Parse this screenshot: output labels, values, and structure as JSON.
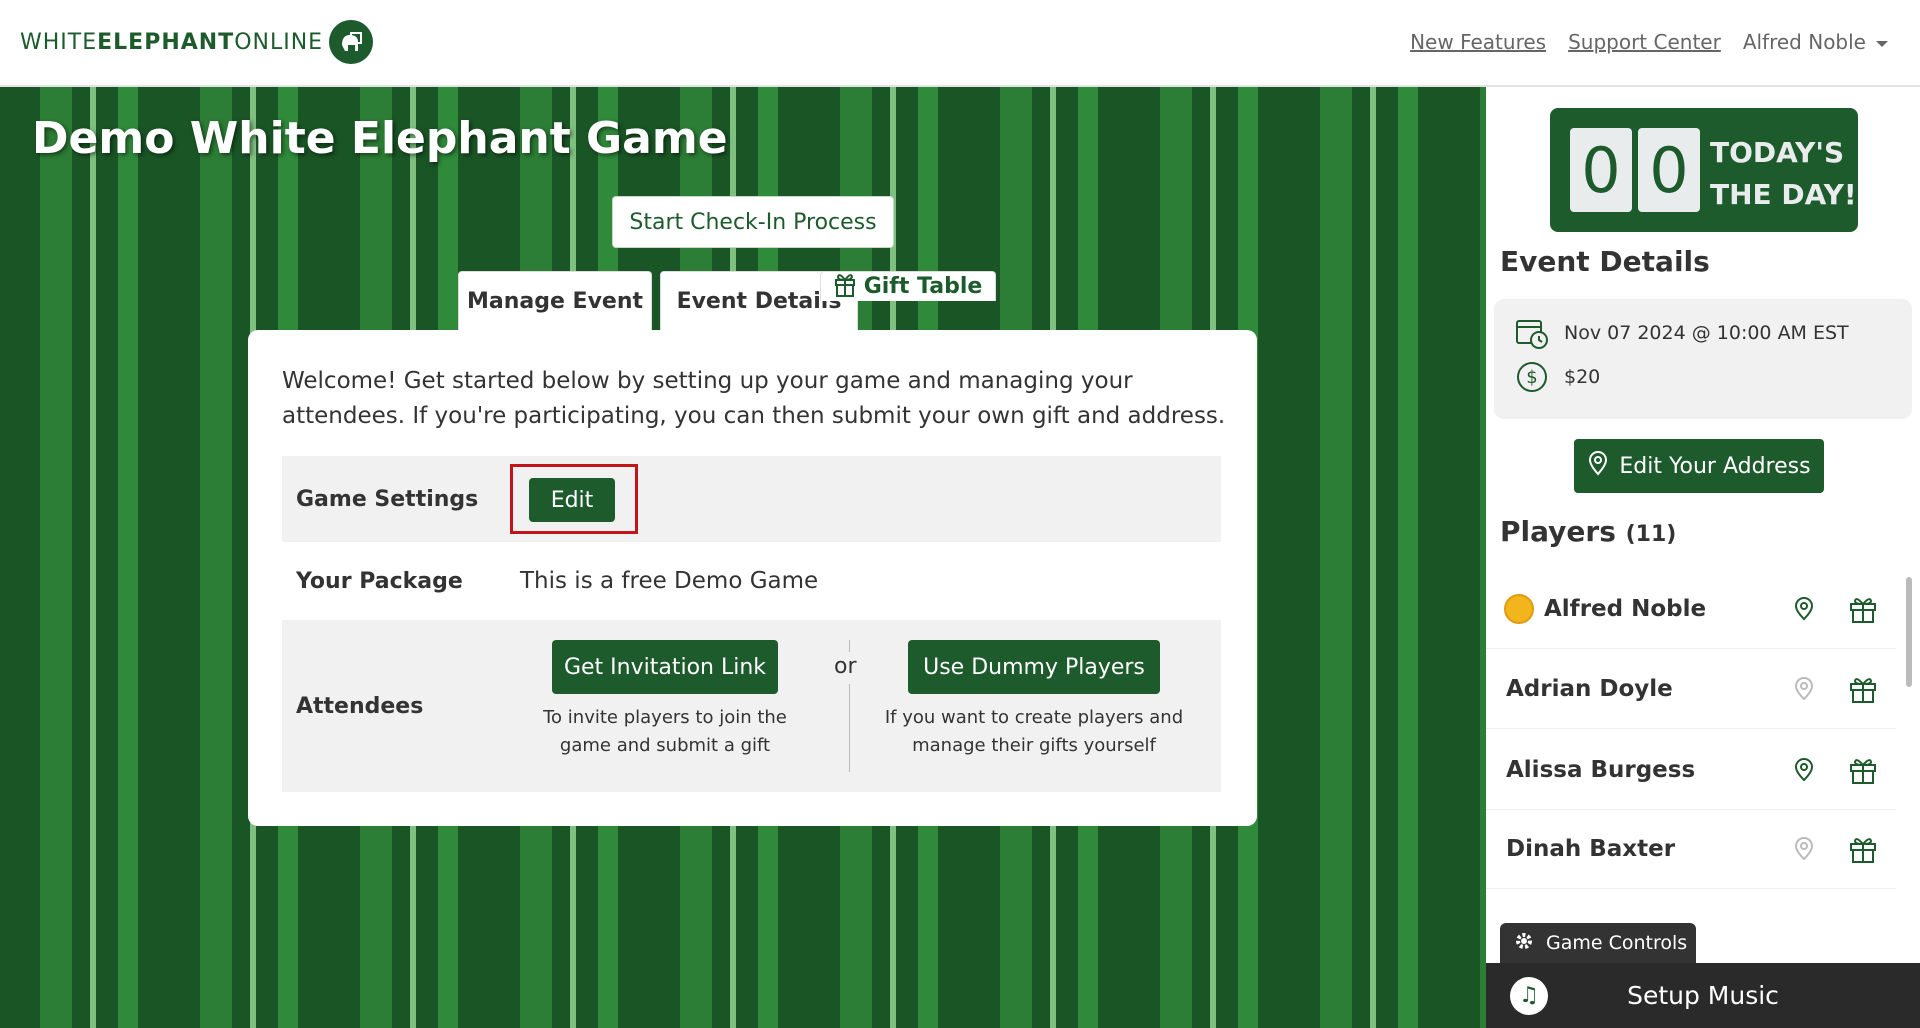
{
  "brand": {
    "logo_text_1": "WHITE ",
    "logo_text_2": "ELEPHANT",
    "logo_text_3": " ONLINE",
    "logo_glyph": "🐘"
  },
  "nav": {
    "new_features": "New Features",
    "support_center": "Support Center",
    "user_menu": "Alfred Noble"
  },
  "game": {
    "title": "Demo White Elephant Game"
  },
  "actions": {
    "check_in": "Start Check-In Process"
  },
  "tabs": [
    {
      "label": "Gift Table"
    },
    {
      "label": "Manage Event"
    },
    {
      "label": "Event Details"
    }
  ],
  "manage": {
    "welcome": "Welcome! Get started below by setting up your game and managing your attendees. If you're participating, you can then submit your own gift and address.",
    "game_settings_label": "Game Settings",
    "edit_label": "Edit",
    "package_label": "Your Package",
    "package_value": "This is a free Demo Game",
    "attendees_label": "Attendees",
    "invite_button": "Get Invitation Link",
    "invite_hint": "To invite players to join the game and submit a gift",
    "or_label": "or",
    "dummy_button": "Use Dummy Players",
    "dummy_hint": "If you want to create players and manage their gifts yourself"
  },
  "countdown": {
    "digit_1": "0",
    "digit_2": "0",
    "line_1": "TODAY'S",
    "line_2": "THE DAY!"
  },
  "event_details": {
    "heading": "Event Details",
    "datetime": "Nov 07 2024 @ 10:00 AM EST",
    "budget": "$20",
    "edit_address": "Edit Your Address"
  },
  "players": {
    "heading": "Players",
    "count": "(11)",
    "list": [
      {
        "name": "Alfred Noble",
        "host": true,
        "address_set": true
      },
      {
        "name": "Adrian Doyle",
        "host": false,
        "address_set": false
      },
      {
        "name": "Alissa Burgess",
        "host": false,
        "address_set": true
      },
      {
        "name": "Dinah Baxter",
        "host": false,
        "address_set": false
      }
    ]
  },
  "footer": {
    "game_controls": "Game Controls",
    "setup_music": "Setup Music"
  },
  "colors": {
    "brand_green": "#1d5b2d",
    "highlight_red": "#c0151b",
    "dark_bar": "#2a2a2a"
  }
}
